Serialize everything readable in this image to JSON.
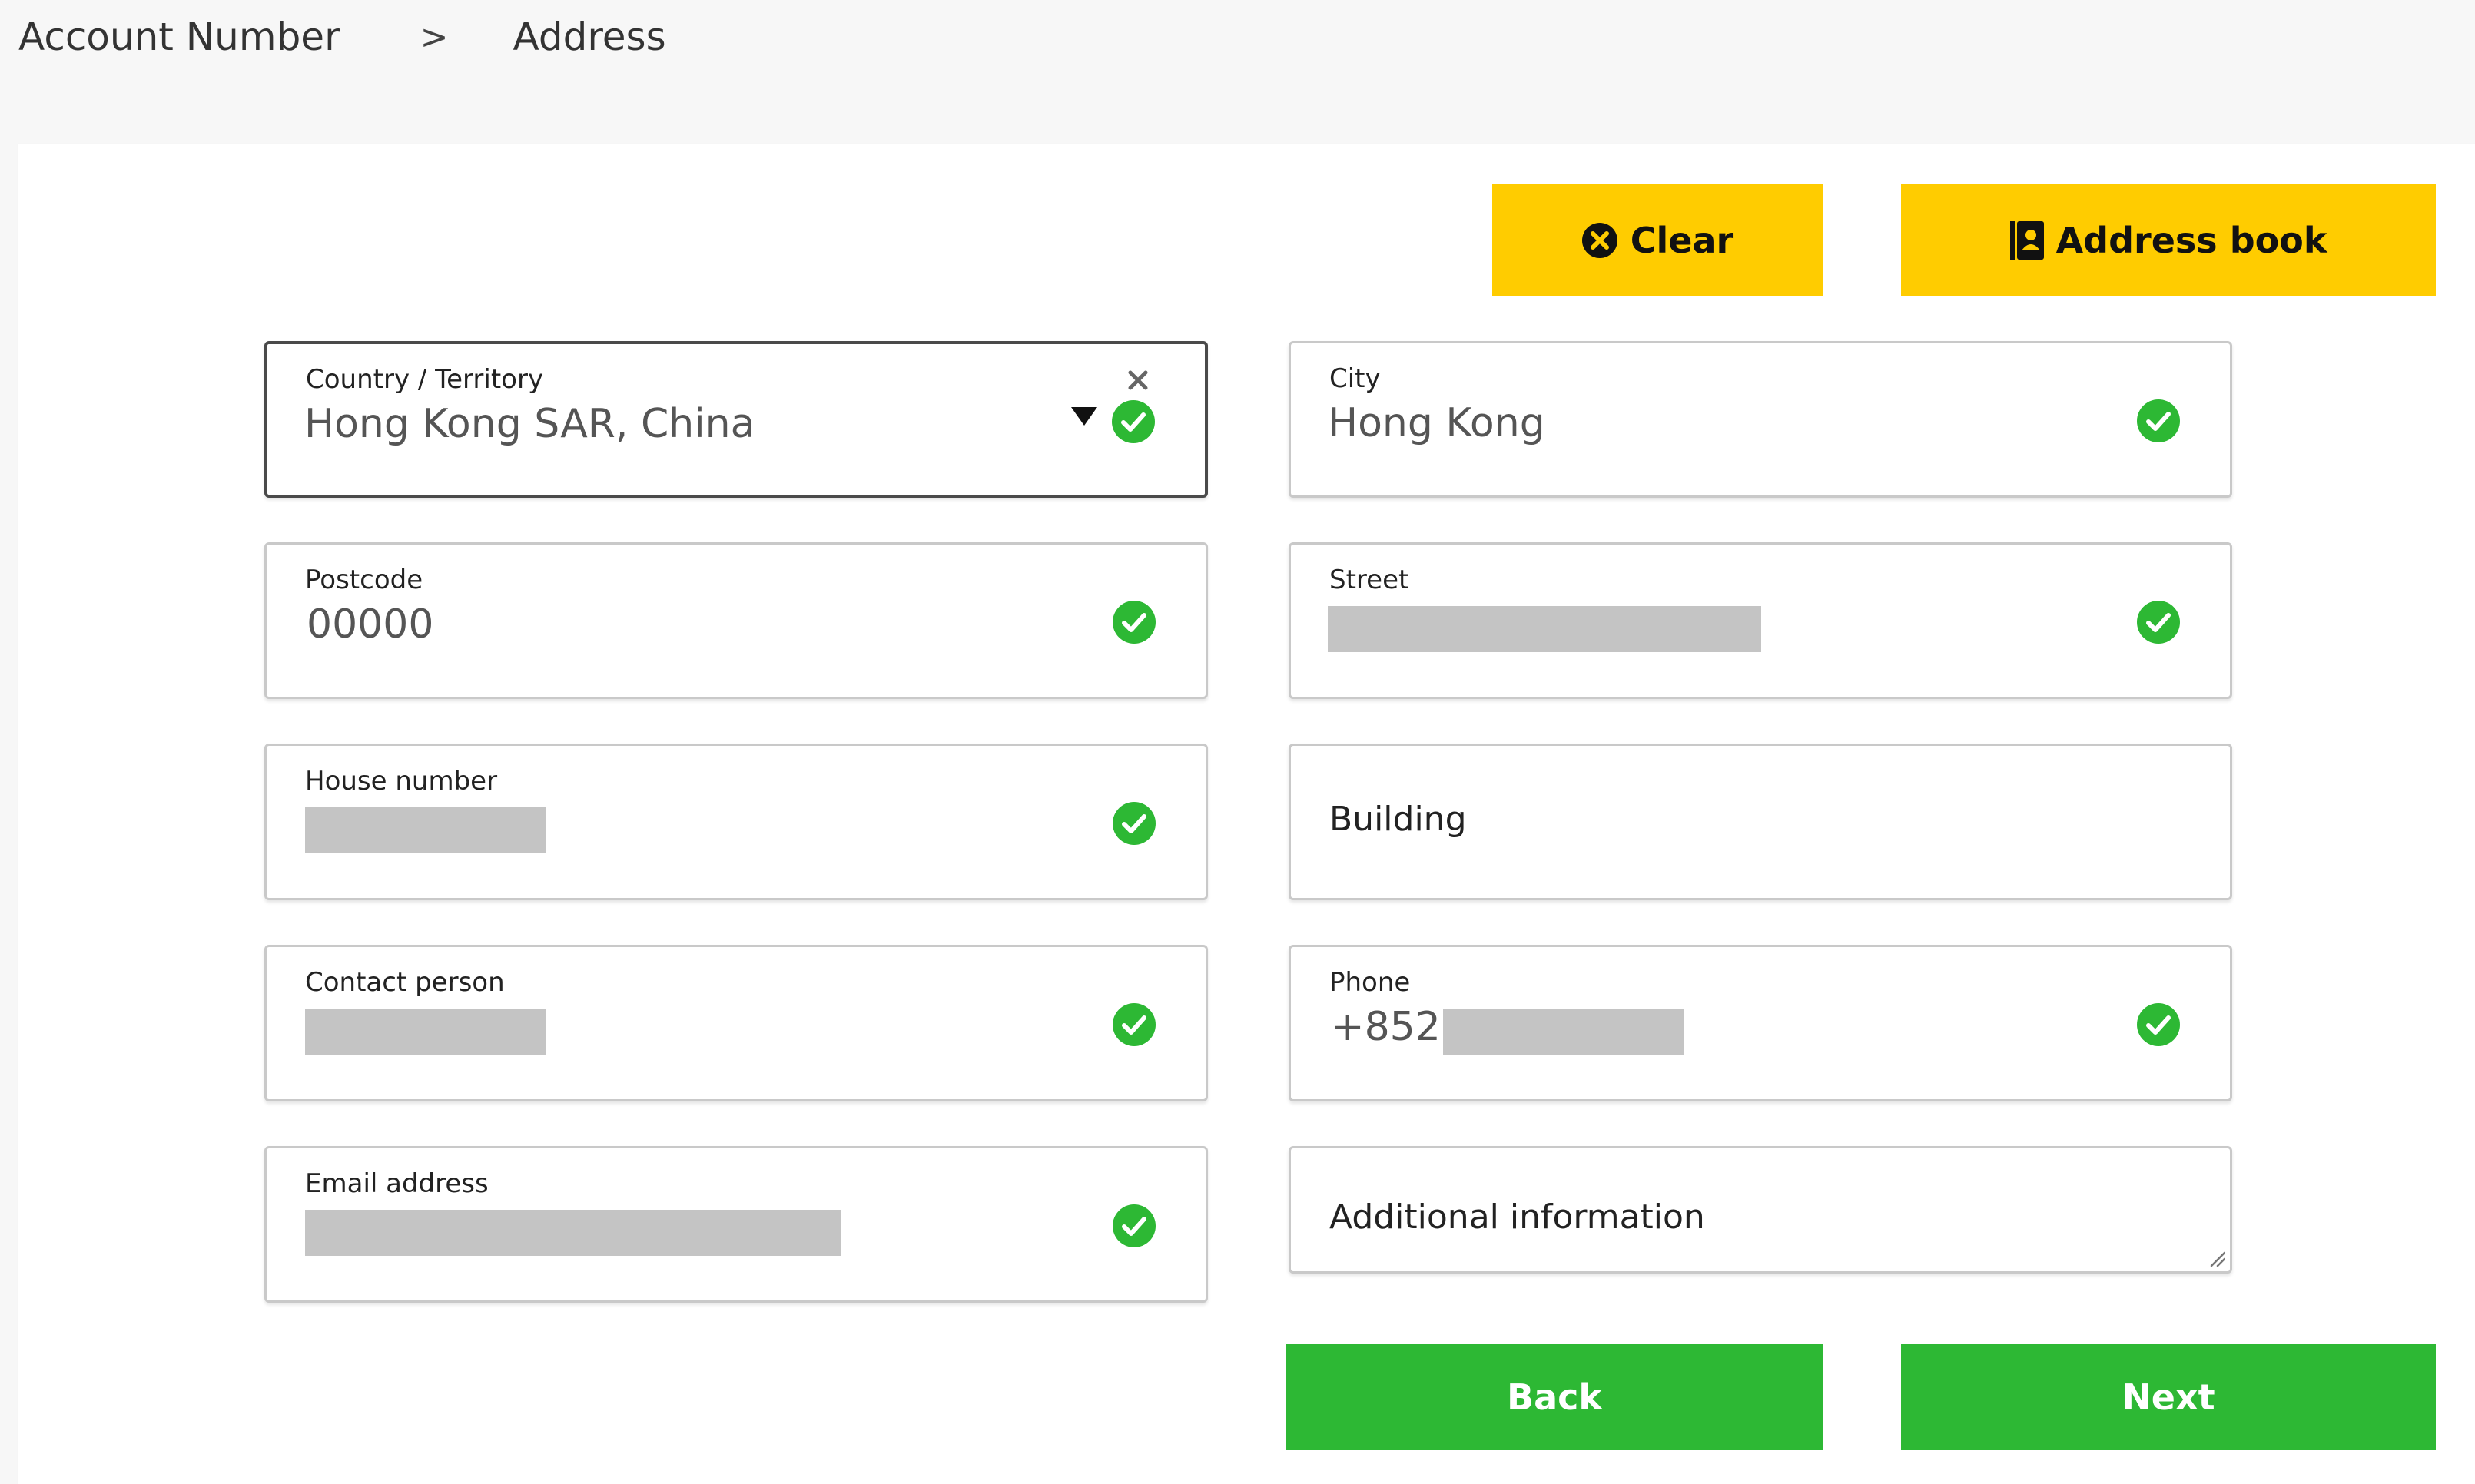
{
  "breadcrumb": {
    "items": [
      "Account Number",
      "Address"
    ],
    "separator": ">"
  },
  "toolbar": {
    "clear_label": "Clear",
    "address_book_label": "Address book"
  },
  "form": {
    "country": {
      "label": "Country / Territory",
      "value": "Hong Kong SAR, China"
    },
    "city": {
      "label": "City",
      "value": "Hong Kong"
    },
    "postcode": {
      "label": "Postcode",
      "value": "00000"
    },
    "street": {
      "label": "Street"
    },
    "house_number": {
      "label": "House number"
    },
    "building": {
      "placeholder": "Building"
    },
    "contact_person": {
      "label": "Contact person"
    },
    "phone": {
      "label": "Phone",
      "prefix": "+852"
    },
    "email": {
      "label": "Email address"
    },
    "additional_info": {
      "placeholder": "Additional information"
    }
  },
  "actions": {
    "back_label": "Back",
    "next_label": "Next"
  },
  "colors": {
    "accent_yellow": "#ffcc00",
    "action_green": "#2db834",
    "valid_check": "#2db834",
    "redaction_gray": "#c4c4c4"
  },
  "icons": {
    "clear": "close-circle-icon",
    "address_book": "address-book-icon",
    "valid": "check-circle-icon",
    "dropdown": "caret-down-icon",
    "clear_field": "close-icon"
  }
}
